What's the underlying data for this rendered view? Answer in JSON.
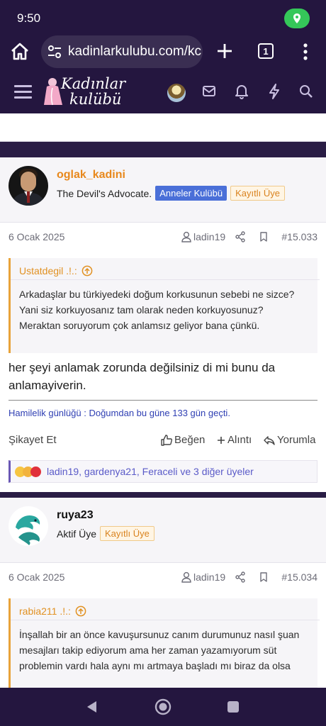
{
  "status": {
    "time": "9:50"
  },
  "browser": {
    "url": "kadinlarkulubu.com/kc",
    "tab_count": "1"
  },
  "site": {
    "logo_line1": "Kadınlar",
    "logo_line2": "kulübü"
  },
  "posts": [
    {
      "username": "oglak_kadini",
      "user_title": "The Devil's Advocate.",
      "badges": [
        "Anneler Kulübü",
        "Kayıtlı Üye"
      ],
      "date": "6 Ocak 2025",
      "author": "ladin19",
      "number": "#15.033",
      "quote_author": "Ustatdegil .!.:",
      "quote_text": "Arkadaşlar bu türkiyedeki doğum korkusunun sebebi ne sizce? Yani siz korkuyosanız tam olarak neden korkuyosunuz? Meraktan soruyorum çok anlamsız geliyor bana çünkü.",
      "message": "her şeyi anlamak zorunda değilsiniz di mi bunu da anlamayiverin.",
      "signature": "Hamilelik günlüğü : Doğumdan bu güne 133 gün geçti.",
      "actions": {
        "report": "Şikayet Et",
        "like": "Beğen",
        "quote": "Alıntı",
        "reply": "Yorumla"
      },
      "reactions": "ladin19, gardenya21, Feraceli ve 3 diğer üyeler"
    },
    {
      "username": "ruya23",
      "user_title": "Aktif Üye",
      "badges": [
        "Kayıtlı Üye"
      ],
      "date": "6 Ocak 2025",
      "author": "ladin19",
      "number": "#15.034",
      "quote_author": "rabia211 .!.:",
      "quote_text": "İnşallah bir an önce kavuşursunuz canım durumunuz nasıl şuan mesajları takip ediyorum ama her zaman yazamıyorum süt problemin vardı hala aynı mı artmaya başladı mı biraz da olsa"
    }
  ],
  "colors": {
    "header": "#24163f",
    "accent": "#e8a33a",
    "username": "#e8881c",
    "badge_blue": "#4a6fd8"
  }
}
